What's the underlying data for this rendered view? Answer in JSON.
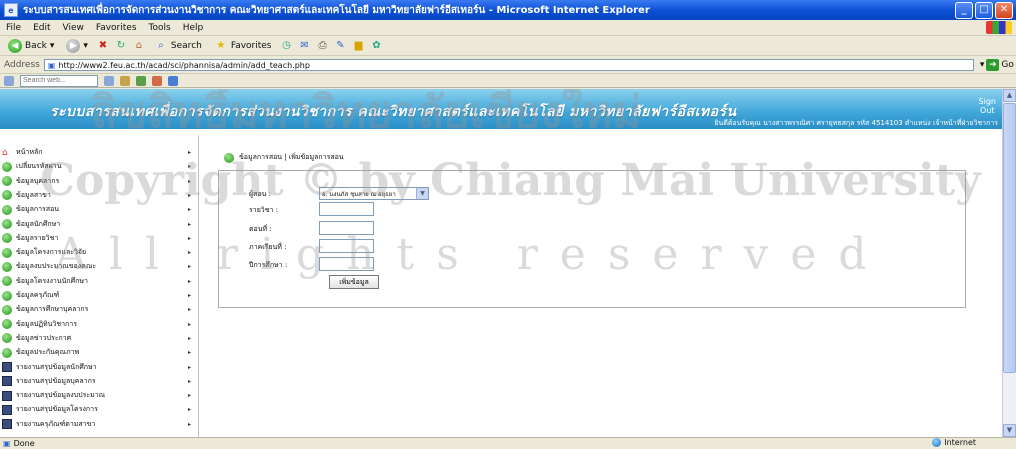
{
  "window": {
    "title": "ระบบสารสนเทศเพื่อการจัดการส่วนงานวิชาการ คณะวิทยาศาสตร์และเทคโนโลยี มหาวิทยาลัยฟาร์อีสเทอร์น - Microsoft Internet Explorer",
    "minimize": "_",
    "maximize": "□",
    "close": "✕"
  },
  "menu": [
    "File",
    "Edit",
    "View",
    "Favorites",
    "Tools",
    "Help"
  ],
  "toolbar": {
    "back": "Back",
    "search": "Search",
    "favorites": "Favorites"
  },
  "address": {
    "label": "Address",
    "url": "http://www2.feu.ac.th/acad/sci/phannisa/admin/add_teach.php",
    "go": "Go"
  },
  "searchbar": {
    "placeholder": "Search web..."
  },
  "banner": {
    "title": "ระบบสารสนเทศเพื่อการจัดการส่วนงานวิชาการ คณะวิทยาศาสตร์และเทคโนโลยี มหาวิทยาลัยฟาร์อีสเทอร์น",
    "signout": "Sign\nOut",
    "info": "ยินดีต้อนรับคุณ นางสาวพรรณิศา ศรายุทธสกุล รหัส 4514103 ตำแหน่ง เจ้าหน้าที่ฝ่ายวิชาการ"
  },
  "sidebar": {
    "items": [
      {
        "label": "หน้าหลัก",
        "icon": "home-icon"
      },
      {
        "label": "เปลี่ยนรหัสผ่าน",
        "icon": "green-circle-icon"
      },
      {
        "label": "ข้อมูลบุคลากร",
        "icon": "green-circle-icon"
      },
      {
        "label": "ข้อมูลสาขา",
        "icon": "green-circle-icon"
      },
      {
        "label": "ข้อมูลการสอน",
        "icon": "green-circle-icon"
      },
      {
        "label": "ข้อมูลนักศึกษา",
        "icon": "green-circle-icon"
      },
      {
        "label": "ข้อมูลรายวิชา",
        "icon": "green-circle-icon"
      },
      {
        "label": "ข้อมูลโครงการและวิจัย",
        "icon": "green-circle-icon"
      },
      {
        "label": "ข้อมูลงบประมาณของคณะ",
        "icon": "green-circle-icon"
      },
      {
        "label": "ข้อมูลโครงงานนักศึกษา",
        "icon": "green-circle-icon"
      },
      {
        "label": "ข้อมูลครุภัณฑ์",
        "icon": "green-circle-icon"
      },
      {
        "label": "ข้อมูลการศึกษาบุคลากร",
        "icon": "green-circle-icon"
      },
      {
        "label": "ข้อมูลปฏิทินวิชาการ",
        "icon": "green-circle-icon"
      },
      {
        "label": "ข้อมูลข่าวประกาศ",
        "icon": "green-circle-icon"
      },
      {
        "label": "ข้อมูลประกันคุณภาพ",
        "icon": "green-circle-icon"
      },
      {
        "label": "รายงานสรุปข้อมูลนักศึกษา",
        "icon": "book-icon"
      },
      {
        "label": "รายงานสรุปข้อมูลบุคลากร",
        "icon": "book-icon"
      },
      {
        "label": "รายงานสรุปข้อมูลงบประมาณ",
        "icon": "book-icon"
      },
      {
        "label": "รายงานสรุปข้อมูลโครงการ",
        "icon": "book-icon"
      },
      {
        "label": "รายงานครุภัณฑ์ตามสาขา",
        "icon": "book-icon"
      }
    ]
  },
  "content": {
    "title": "ข้อมูลการสอน | เพิ่มข้อมูลการสอน",
    "fields": {
      "teacher_label": "ผู้สอน :",
      "teacher_value": "อ. นงนภัส ชุมสาย ณ อยุธยา",
      "course_label": "รายวิชา :",
      "section_label": "ตอนที่ :",
      "semester_label": "ภาคเรียนที่ :",
      "year_label": "ปีการศึกษา :"
    },
    "add_button": "เพิ่มข้อมูล"
  },
  "watermark": {
    "line1": "ลิขสิทธิ์มหาวิทยาลัยเชียงใหม่",
    "line2": "Copyright © by Chiang Mai University",
    "line3": "All rights reserved"
  },
  "status": {
    "done": "Done",
    "zone": "Internet"
  }
}
